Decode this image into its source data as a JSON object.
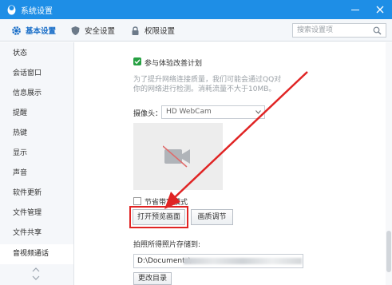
{
  "window": {
    "title": "系统设置"
  },
  "tabs": [
    {
      "label": "基本设置",
      "icon": "gear-icon"
    },
    {
      "label": "安全设置",
      "icon": "shield-icon"
    },
    {
      "label": "权限设置",
      "icon": "lock-icon"
    }
  ],
  "search": {
    "placeholder": "搜索设置项",
    "value": ""
  },
  "sidebar": {
    "items": [
      {
        "label": "状态"
      },
      {
        "label": "会话窗口"
      },
      {
        "label": "信息展示"
      },
      {
        "label": "提醒"
      },
      {
        "label": "热键"
      },
      {
        "label": "显示"
      },
      {
        "label": "声音"
      },
      {
        "label": "软件更新"
      },
      {
        "label": "文件管理"
      },
      {
        "label": "文件共享"
      },
      {
        "label": "音视频通话"
      }
    ],
    "active_index": 10
  },
  "content": {
    "experience": {
      "label": "参与体验改善计划",
      "checked": true,
      "desc_line1": "为了提升网络连接质量，我们可能会通过QQ对",
      "desc_line2": "你的网络进行检测。消耗流量不大于10MB。"
    },
    "camera": {
      "label": "摄像头：",
      "selected": "HD WebCam"
    },
    "preview_icon": "camera-off-icon",
    "power_saving": {
      "label": "节省带宽模式",
      "checked": false
    },
    "open_preview_button": "打开预览画面",
    "quality_button": "画质调节",
    "save_path": {
      "label": "拍照所得照片存储到:",
      "value": "D:\\Documents\\"
    },
    "change_dir_button": "更改目录"
  },
  "colors": {
    "titlebar": "#1e8ee6",
    "accent": "#1a6fc8",
    "check": "#26a042",
    "highlight": "#e02424"
  }
}
